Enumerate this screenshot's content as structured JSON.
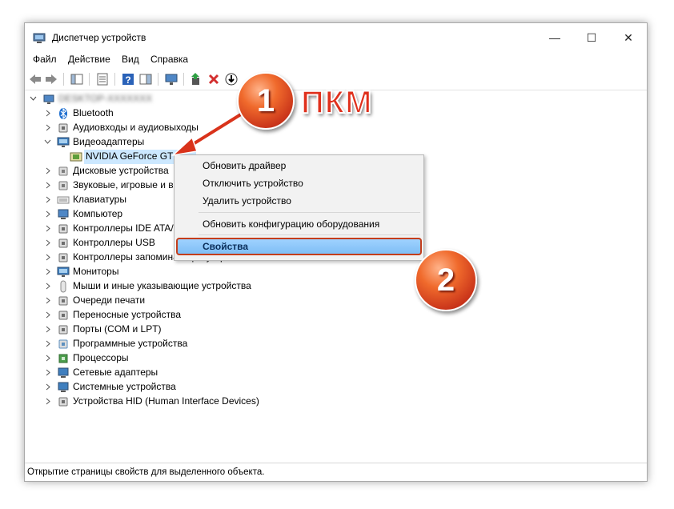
{
  "window": {
    "title": "Диспетчер устройств",
    "minimize": "—",
    "maximize": "☐",
    "close": "✕"
  },
  "menu": [
    "Файл",
    "Действие",
    "Вид",
    "Справка"
  ],
  "tree": {
    "root_label": "DESKTOP-XXXXXXX",
    "selected": "NVIDIA GeForce GT",
    "items": [
      {
        "label": "Bluetooth",
        "icon": "bluetooth-icon"
      },
      {
        "label": "Аудиовходы и аудиовыходы",
        "icon": "audio-icon"
      },
      {
        "label": "Видеоадаптеры",
        "icon": "display-adapter-icon"
      },
      {
        "label": "NVIDIA GeForce GT",
        "icon": "gpu-icon"
      },
      {
        "label": "Дисковые устройства",
        "icon": "disk-icon"
      },
      {
        "label": "Звуковые, игровые и в",
        "icon": "sound-icon"
      },
      {
        "label": "Клавиатуры",
        "icon": "keyboard-icon"
      },
      {
        "label": "Компьютер",
        "icon": "computer-icon"
      },
      {
        "label": "Контроллеры IDE ATA/",
        "icon": "ide-icon"
      },
      {
        "label": "Контроллеры USB",
        "icon": "usb-icon"
      },
      {
        "label": "Контроллеры запоминающих устройств",
        "icon": "storage-controller-icon"
      },
      {
        "label": "Мониторы",
        "icon": "monitor-icon"
      },
      {
        "label": "Мыши и иные указывающие устройства",
        "icon": "mouse-icon"
      },
      {
        "label": "Очереди печати",
        "icon": "printer-icon"
      },
      {
        "label": "Переносные устройства",
        "icon": "portable-device-icon"
      },
      {
        "label": "Порты (COM и LPT)",
        "icon": "port-icon"
      },
      {
        "label": "Программные устройства",
        "icon": "software-device-icon"
      },
      {
        "label": "Процессоры",
        "icon": "processor-icon"
      },
      {
        "label": "Сетевые адаптеры",
        "icon": "network-adapter-icon"
      },
      {
        "label": "Системные устройства",
        "icon": "system-device-icon"
      },
      {
        "label": "Устройства HID (Human Interface Devices)",
        "icon": "hid-icon"
      }
    ]
  },
  "context_menu": {
    "update_driver": "Обновить драйвер",
    "disable_device": "Отключить устройство",
    "uninstall_device": "Удалить устройство",
    "scan_hardware": "Обновить конфигурацию оборудования",
    "properties": "Свойства"
  },
  "annotations": {
    "step1": "1",
    "step1_label": "ПКМ",
    "step2": "2",
    "badge_color": "#e0521f",
    "highlight_border": "#c43d1a"
  },
  "status": "Открытие страницы свойств для выделенного объекта."
}
